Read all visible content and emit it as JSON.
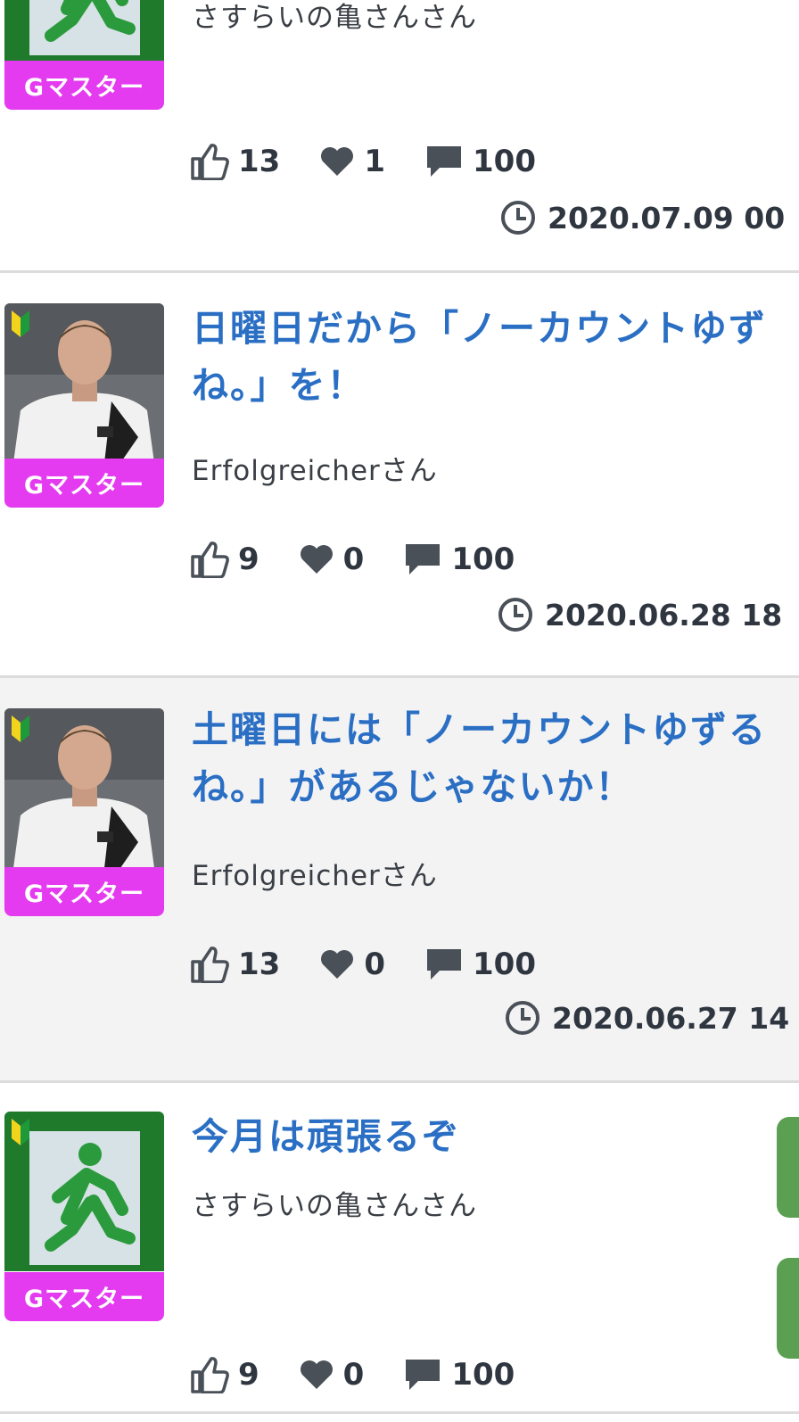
{
  "threads": [
    {
      "rank": "Gマスター",
      "author": "さすらいの亀さんさん",
      "likes": "13",
      "favorites": "1",
      "comments": "100",
      "date": "2020.07.09 00"
    },
    {
      "title": "日曜日だから「ノーカウントゆず\nね。」を！",
      "rank": "Gマスター",
      "author": "Erfolgreicherさん",
      "likes": "9",
      "favorites": "0",
      "comments": "100",
      "date": "2020.06.28 18"
    },
    {
      "title": "土曜日には「ノーカウントゆずる\nね。」があるじゃないか！",
      "rank": "Gマスター",
      "author": "Erfolgreicherさん",
      "likes": "13",
      "favorites": "0",
      "comments": "100",
      "date": "2020.06.27 14"
    },
    {
      "title": "今月は頑張るぞ",
      "rank": "Gマスター",
      "author": "さすらいの亀さんさん",
      "likes": "9",
      "favorites": "0",
      "comments": "100"
    }
  ],
  "colors": {
    "title": "#2a6fc4",
    "rank_badge": "#e43bf0",
    "alt_background": "#f3f3f4",
    "side_tab": "#5a9f52"
  },
  "icons": [
    "thumbs-up-icon",
    "heart-icon",
    "comment-icon",
    "clock-icon",
    "beginner-mark-icon",
    "exit-sign-avatar",
    "person-avatar"
  ]
}
